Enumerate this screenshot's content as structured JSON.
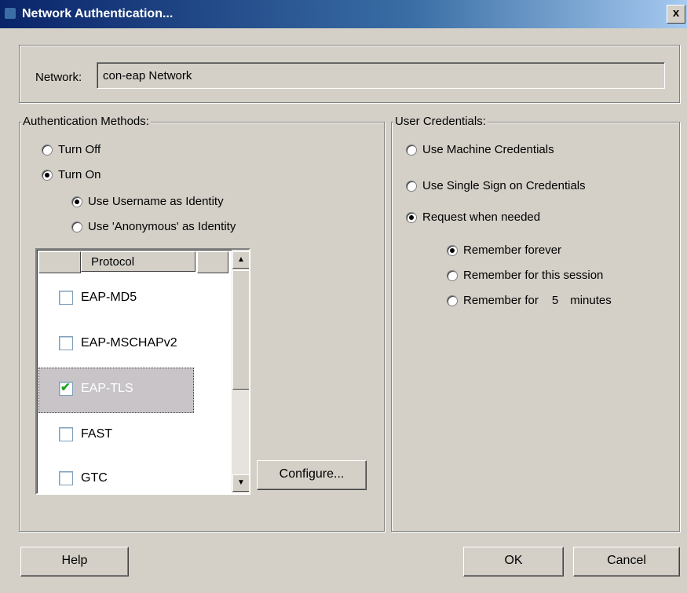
{
  "window": {
    "title": "Network Authentication...",
    "close_glyph": "x"
  },
  "network": {
    "label": "Network:",
    "value": "con-eap Network"
  },
  "auth_methods": {
    "legend": "Authentication Methods:",
    "turn_off": "Turn Off",
    "turn_on": "Turn On",
    "use_username": "Use Username as Identity",
    "use_anonymous": "Use 'Anonymous' as Identity",
    "selected": "turn_on",
    "identity_selected": "use_username"
  },
  "protocol_list": {
    "header": "Protocol",
    "items": [
      {
        "label": "EAP-MD5",
        "checked": false
      },
      {
        "label": "EAP-MSCHAPv2",
        "checked": false
      },
      {
        "label": "EAP-TLS",
        "checked": true
      },
      {
        "label": "FAST",
        "checked": false
      },
      {
        "label": "GTC",
        "checked": false
      }
    ],
    "selected_item": "EAP-TLS",
    "scroll_up": "▲",
    "scroll_down": "▼"
  },
  "configure_button": "Configure...",
  "user_credentials": {
    "legend": "User Credentials:",
    "machine": "Use Machine Credentials",
    "sso": "Use Single Sign on Credentials",
    "request": "Request when needed",
    "selected": "request",
    "remember_forever": "Remember forever",
    "remember_session": "Remember for this session",
    "remember_for": "Remember for",
    "remember_minutes_value": "5",
    "remember_minutes_unit": "minutes",
    "remember_selected": "forever"
  },
  "buttons": {
    "help": "Help",
    "ok": "OK",
    "cancel": "Cancel"
  }
}
